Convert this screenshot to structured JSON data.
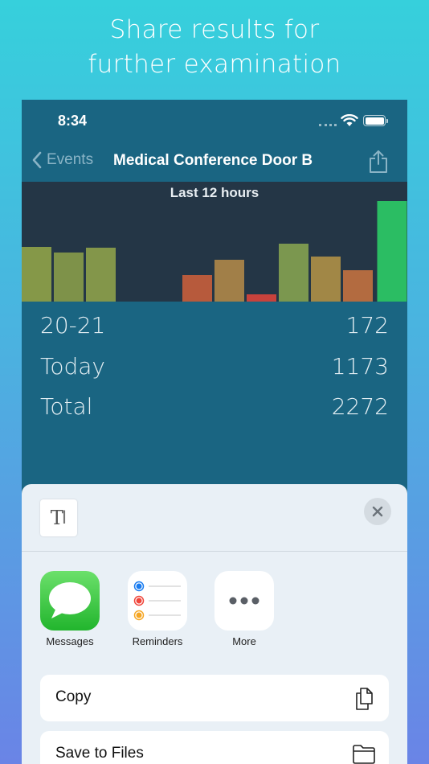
{
  "promo": {
    "line1": "Share results for",
    "line2": "further examination"
  },
  "status_bar": {
    "time": "8:34",
    "icons": [
      "signal-dots-icon",
      "wifi-icon",
      "battery-icon"
    ]
  },
  "nav": {
    "back_label": "Events",
    "title": "Medical Conference Door B",
    "share_icon": "share-icon"
  },
  "chart_data": {
    "type": "bar",
    "title": "Last 12 hours",
    "values": [
      68,
      61,
      67,
      0,
      0,
      33,
      52,
      9,
      72,
      56,
      39,
      125
    ],
    "colors": [
      "#859848",
      "#7e9249",
      "#83964a",
      "#243646",
      "#243646",
      "#b75a3c",
      "#a17f48",
      "#c8423c",
      "#7b974f",
      "#a18746",
      "#b36b40",
      "#2bbd63"
    ],
    "ylim": [
      0,
      145
    ],
    "grid": false
  },
  "stats": [
    {
      "label": "20-21",
      "value": "172"
    },
    {
      "label": "Today",
      "value": "1173"
    },
    {
      "label": "Total",
      "value": "2272"
    }
  ],
  "share_sheet": {
    "doc_icon": "text-document-icon",
    "doc_glyph": "T",
    "close_icon": "close-icon",
    "apps": [
      {
        "label": "Messages",
        "icon": "messages-icon"
      },
      {
        "label": "Reminders",
        "icon": "reminders-icon"
      },
      {
        "label": "More",
        "icon": "more-icon"
      }
    ],
    "actions": [
      {
        "label": "Copy",
        "icon": "copy-icon"
      },
      {
        "label": "Save to Files",
        "icon": "folder-icon"
      }
    ]
  }
}
